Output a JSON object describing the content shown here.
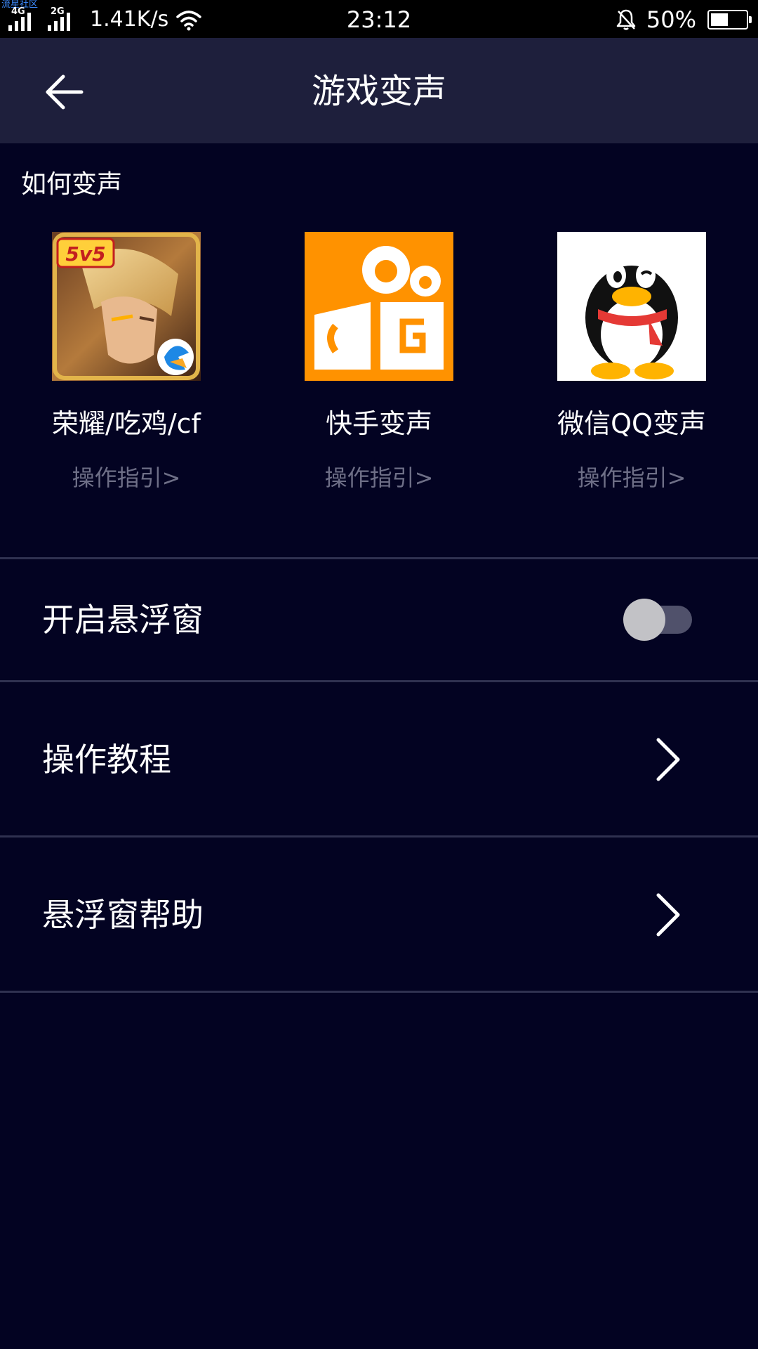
{
  "status_bar": {
    "watermark": "流星社区",
    "network1": "4G",
    "network2": "2G",
    "speed": "1.41K/s",
    "time": "23:12",
    "battery_text": "50%",
    "battery_level": 0.5
  },
  "header": {
    "title": "游戏变声"
  },
  "how_section": {
    "label": "如何变声",
    "apps": [
      {
        "name": "荣耀/吃鸡/cf",
        "guide": "操作指引>"
      },
      {
        "name": "快手变声",
        "guide": "操作指引>",
        "icon_color": "#ff9200"
      },
      {
        "name": "微信QQ变声",
        "guide": "操作指引>"
      }
    ]
  },
  "settings": {
    "floating_window": {
      "label": "开启悬浮窗",
      "enabled": false
    },
    "tutorial": {
      "label": "操作教程"
    },
    "floating_help": {
      "label": "悬浮窗帮助"
    }
  },
  "colors": {
    "background": "#030322",
    "header_background": "#1e1f3c",
    "divider": "#2f3150",
    "guide_text": "#6e6f87"
  }
}
